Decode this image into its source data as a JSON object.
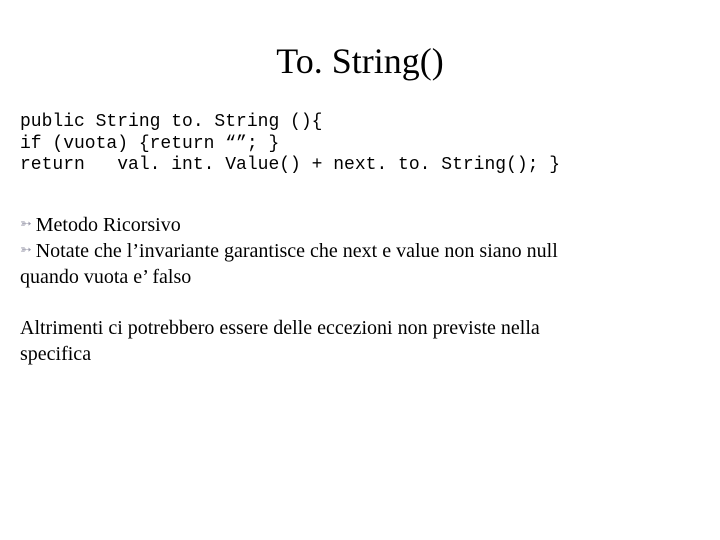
{
  "title": "To. String()",
  "code": {
    "line1": "public String to. String (){",
    "line2": "if (vuota) {return “”; }",
    "line3": "return   val. int. Value() + next. to. String(); }"
  },
  "bullets": {
    "item1": "Metodo Ricorsivo",
    "item2_line1": "Notate che l’invariante garantisce che next e value non siano null",
    "item2_line2": "quando vuota e’ falso"
  },
  "paragraph": {
    "line1": "Altrimenti ci potrebbero essere delle eccezioni non previste nella",
    "line2": "specifica"
  }
}
